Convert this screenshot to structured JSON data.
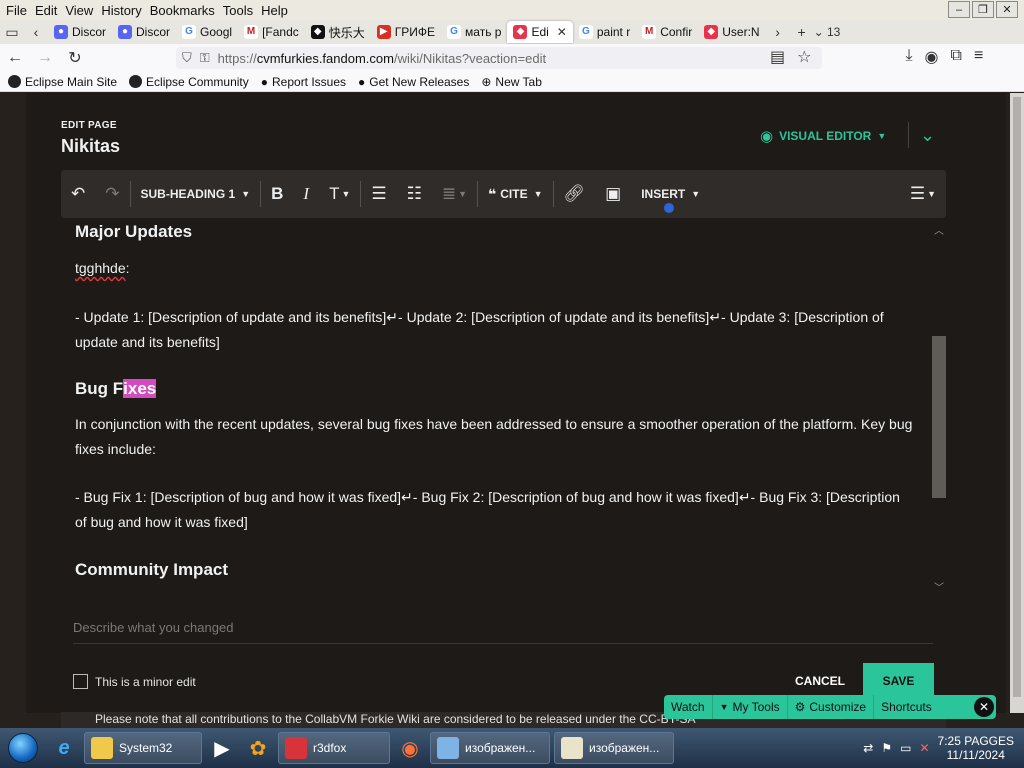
{
  "menu": [
    "File",
    "Edit",
    "View",
    "History",
    "Bookmarks",
    "Tools",
    "Help"
  ],
  "tabs": [
    {
      "label": "Discor",
      "color": "#5865f2"
    },
    {
      "label": "Discor",
      "color": "#5865f2"
    },
    {
      "label": "Googl",
      "color": "#4285f4"
    },
    {
      "label": "[Fandc",
      "color": "#c5221f"
    },
    {
      "label": "快乐大",
      "color": "#111111"
    },
    {
      "label": "ГРИФЕ",
      "color": "#d93025"
    },
    {
      "label": "мать р",
      "color": "#4285f4"
    },
    {
      "label": "Edi",
      "color": "#e8334a"
    },
    {
      "label": "paint r",
      "color": "#4285f4"
    },
    {
      "label": "Confir",
      "color": "#c5221f"
    },
    {
      "label": "User:N",
      "color": "#e8334a"
    }
  ],
  "tab_count": "13",
  "url": {
    "prefix": "https://",
    "domain": "cvmfurkies.fandom.com",
    "path": "/wiki/Nikitas?veaction=edit"
  },
  "bookmarks": [
    "Eclipse Main Site",
    "Eclipse Community",
    "Report Issues",
    "Get New Releases",
    "New Tab"
  ],
  "page": {
    "edit_label": "EDIT PAGE",
    "title": "Nikitas",
    "visual_editor": "VISUAL EDITOR"
  },
  "toolbar": {
    "heading": "SUB-HEADING 1",
    "cite": "CITE",
    "insert": "INSERT"
  },
  "content": {
    "h_major": "Major Updates",
    "tag": "tgghhde",
    "tag_colon": ":",
    "updates": "- Update 1: [Description of update and its benefits]↵- Update 2: [Description of update and its benefits]↵- Update 3: [Description of update and its benefits]",
    "h_bug_a": "Bug F",
    "h_bug_b": "ixes",
    "bug_intro": "In conjunction with the recent updates, several bug fixes have been addressed to ensure a smoother operation of the platform. Key bug fixes include:",
    "bugs": "- Bug Fix 1: [Description of bug and how it was fixed]↵- Bug Fix 2: [Description of bug and how it was fixed]↵- Bug Fix 3: [Description of bug and how it was fixed]",
    "h_community": "Community Impact"
  },
  "summary_placeholder": "Describe what you changed",
  "minor_edit": "This is a minor edit",
  "buttons": {
    "cancel": "CANCEL",
    "save": "SAVE"
  },
  "notice": "Please note that all contributions to the CollabVM Forkie Wiki are considered to be released under the CC-BY-SA",
  "fandom_bar": {
    "watch": "Watch",
    "my_tools": "My Tools",
    "customize": "Customize",
    "shortcuts": "Shortcuts"
  },
  "taskbar": {
    "tasks": [
      "System32",
      "r3dfox",
      "изображен...",
      "изображен..."
    ],
    "time": "7:25 PAGGES",
    "date": "11/11/2024"
  }
}
